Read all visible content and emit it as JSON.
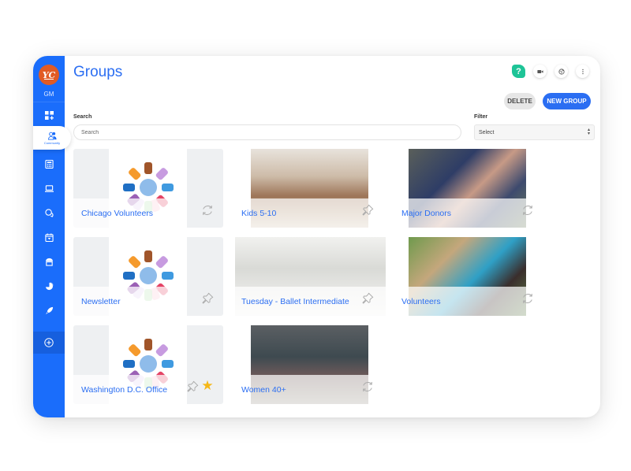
{
  "app": {
    "logo_text": "YC",
    "user_initials": "GM",
    "accent_color": "#1a6dfb"
  },
  "sidebar": {
    "items": [
      {
        "id": "dashboard",
        "icon": "dashboard-icon"
      },
      {
        "id": "community",
        "icon": "community-icon",
        "label": "Community",
        "active": true
      },
      {
        "id": "calculator",
        "icon": "calculator-icon"
      },
      {
        "id": "laptop",
        "icon": "laptop-icon"
      },
      {
        "id": "chat",
        "icon": "chat-icon"
      },
      {
        "id": "calendar",
        "icon": "calendar-icon"
      },
      {
        "id": "store",
        "icon": "store-icon"
      },
      {
        "id": "pie",
        "icon": "pie-chart-icon"
      },
      {
        "id": "launch",
        "icon": "rocket-icon"
      },
      {
        "id": "add",
        "icon": "plus-circle-icon"
      }
    ]
  },
  "header": {
    "title": "Groups",
    "icons": [
      "help-icon",
      "video-icon",
      "globe-icon",
      "more-vertical-icon"
    ],
    "help_label": "?"
  },
  "toolbar": {
    "delete_label": "DELETE",
    "new_group_label": "NEW GROUP"
  },
  "search": {
    "label": "Search",
    "placeholder": "Search",
    "value": ""
  },
  "filter": {
    "label": "Filter",
    "selected": "Select"
  },
  "groups": [
    {
      "name": "Chicago Volunteers",
      "image": "hands-logo",
      "action": "sync-icon",
      "favorite": false
    },
    {
      "name": "Kids 5-10",
      "image": "horses-photo",
      "action": "pin-icon",
      "favorite": false
    },
    {
      "name": "Major Donors",
      "image": "donation-hands-photo",
      "action": "sync-icon",
      "favorite": false
    },
    {
      "name": "Newsletter",
      "image": "hands-logo",
      "action": "pin-icon",
      "favorite": false
    },
    {
      "name": "Tuesday - Ballet Intermediate",
      "image": "ballet-photo",
      "action": "pin-icon",
      "favorite": false
    },
    {
      "name": "Volunteers",
      "image": "volunteers-photo",
      "action": "sync-icon",
      "favorite": false
    },
    {
      "name": "Washington D.C. Office",
      "image": "hands-logo",
      "action": "pin-icon",
      "favorite": true
    },
    {
      "name": "Women 40+",
      "image": "truck-photo",
      "action": "sync-icon",
      "favorite": false
    }
  ]
}
